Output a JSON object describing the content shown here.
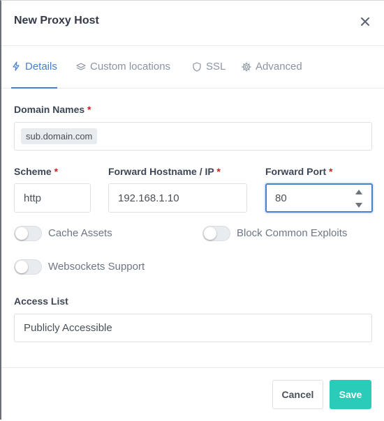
{
  "modal": {
    "title": "New Proxy Host"
  },
  "tabs": [
    {
      "label": "Details",
      "icon": "bolt-icon",
      "active": true
    },
    {
      "label": "Custom locations",
      "icon": "layers-icon",
      "active": false
    },
    {
      "label": "SSL",
      "icon": "shield-icon",
      "active": false
    },
    {
      "label": "Advanced",
      "icon": "gear-icon",
      "active": false
    }
  ],
  "form": {
    "domain_names": {
      "label": "Domain Names",
      "required": "*",
      "values": [
        "sub.domain.com"
      ]
    },
    "scheme": {
      "label": "Scheme",
      "required": "*",
      "value": "http"
    },
    "forward_host": {
      "label": "Forward Hostname / IP",
      "required": "*",
      "value": "192.168.1.10"
    },
    "forward_port": {
      "label": "Forward Port",
      "required": "*",
      "value": "80"
    },
    "cache_assets": {
      "label": "Cache Assets",
      "checked": false
    },
    "block_exploits": {
      "label": "Block Common Exploits",
      "checked": false
    },
    "websockets": {
      "label": "Websockets Support",
      "checked": false
    },
    "access_list": {
      "label": "Access List",
      "value": "Publicly Accessible"
    }
  },
  "footer": {
    "cancel_label": "Cancel",
    "save_label": "Save"
  },
  "colors": {
    "accent": "#467fcf",
    "save": "#2bcbba",
    "required": "#cd201f"
  }
}
